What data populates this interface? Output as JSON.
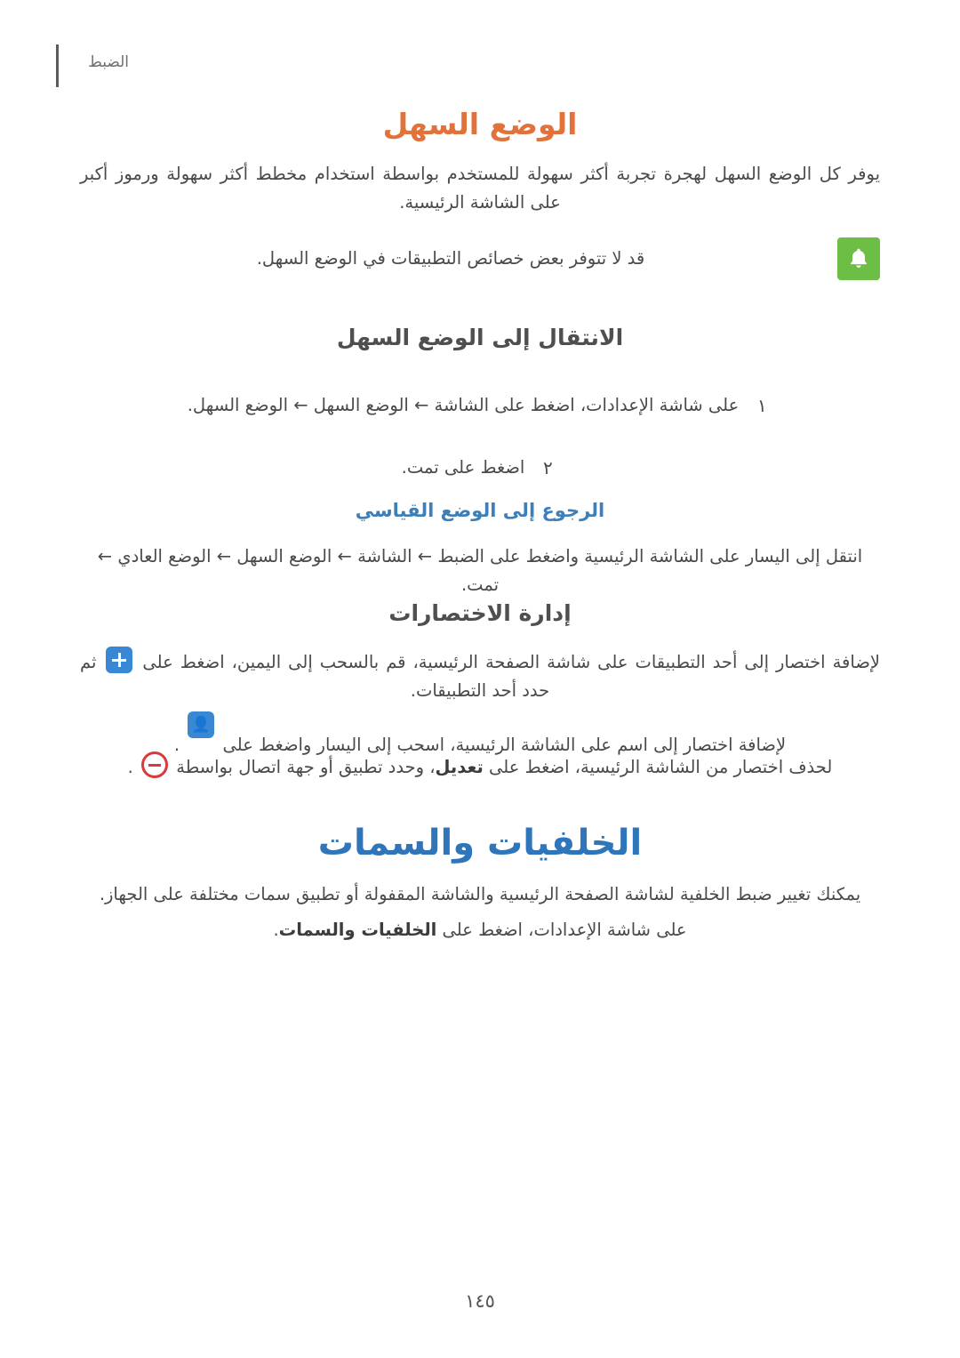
{
  "header": {
    "running_head": "الضبط"
  },
  "sections": [
    {
      "title": "الوضع السهل",
      "intro": "يوفر كل الوضع السهل لهجرة تجربة أكثر سهولة للمستخدم بواسطة استخدام مخطط أكثر سهولة ورموز أكبر على الشاشة الرئيسية.",
      "note": "قد لا تتوفر بعض خصائص التطبيقات في الوضع السهل.",
      "note_icon": "bell-icon",
      "sub1_title": "الانتقال إلى الوضع السهل",
      "steps": [
        {
          "num": "١",
          "parts": [
            "على شاشة الإعدادات، اضغط على الشاشة",
            "الوضع السهل",
            "الوضع السهل"
          ],
          "text": "على شاشة الإعدادات، اضغط على الشاشة ← الوضع السهل ← الوضع السهل."
        },
        {
          "num": "٢",
          "text": "اضغط على تمت."
        }
      ],
      "sub2_title": "الرجوع إلى الوضع القياسي",
      "sub2_text": "انتقل إلى اليسار على الشاشة الرئيسية واضغط على الضبط ← الشاشة ← الوضع السهل ← الوضع العادي ← تمت.",
      "sub3_title": "إدارة الاختصارات",
      "sub3_p1_a": "لإضافة اختصار إلى أحد التطبيقات على شاشة الصفحة الرئيسية، قم بالسحب إلى اليمين، اضغط على",
      "sub3_p1_b": "ثم حدد أحد التطبيقات.",
      "sub3_p1_icon": "plus-icon",
      "sub3_p2_a": "لإضافة اختصار إلى اسم على الشاشة الرئيسية، اسحب إلى اليسار واضغط على",
      "sub3_p2_icon": "add-contact-icon",
      "sub3_p3_a": "لحذف اختصار من الشاشة الرئيسية، اضغط على",
      "sub3_p3_bold": "تعديل",
      "sub3_p3_b": "، وحدد تطبيق أو جهة اتصال بواسطة",
      "sub3_p3_icon": "minus-icon"
    },
    {
      "title": "الخلفيات والسمات",
      "intro": "يمكنك تغيير ضبط الخلفية لشاشة الصفحة الرئيسية والشاشة المقفولة أو تطبيق سمات مختلفة على الجهاز.",
      "line2_a": "على شاشة الإعدادات، اضغط على",
      "line2_bold": "الخلفيات والسمات",
      "line2_b": "."
    }
  ],
  "footer": {
    "page_number": "١٤٥"
  },
  "colors": {
    "heading_blue": "#2f75b9",
    "heading_orange": "#e3713a",
    "subheading_blue": "#3e7fb9",
    "note_green": "#6cbe45",
    "icon_blue": "#3a87d4",
    "icon_red": "#d93a3a"
  }
}
